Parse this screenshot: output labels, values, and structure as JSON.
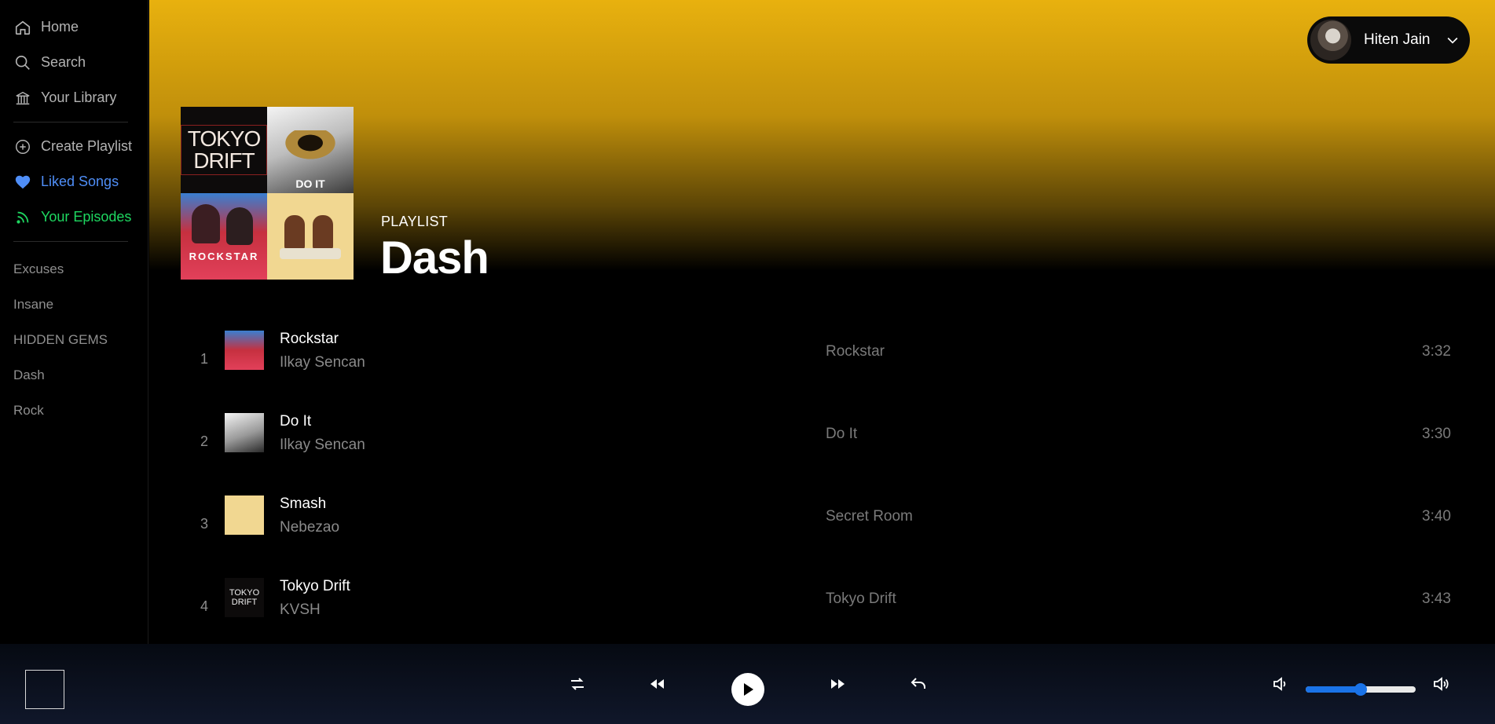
{
  "nav": {
    "home": "Home",
    "search": "Search",
    "library": "Your Library",
    "create_playlist": "Create Playlist",
    "liked_songs": "Liked Songs",
    "your_episodes": "Your Episodes"
  },
  "playlists": [
    "Excuses",
    "Insane",
    "HIDDEN GEMS",
    "Dash",
    "Rock"
  ],
  "user": {
    "name": "Hiten Jain"
  },
  "header": {
    "type": "PLAYLIST",
    "title": "Dash",
    "cover_labels": {
      "tokyo": "TOKYO DRIFT",
      "doit": "DO IT",
      "rockstar": "ROCKSTAR"
    }
  },
  "tracks": [
    {
      "number": "1",
      "title": "Rockstar",
      "artist": "Ilkay Sencan",
      "album": "Rockstar",
      "duration": "3:32",
      "art": "rockstar"
    },
    {
      "number": "2",
      "title": "Do It",
      "artist": "Ilkay Sencan",
      "album": "Do It",
      "duration": "3:30",
      "art": "doit"
    },
    {
      "number": "3",
      "title": "Smash",
      "artist": "Nebezao",
      "album": "Secret Room",
      "duration": "3:40",
      "art": "smash"
    },
    {
      "number": "4",
      "title": "Tokyo Drift",
      "artist": "KVSH",
      "album": "Tokyo Drift",
      "duration": "3:43",
      "art": "tokyo"
    }
  ],
  "player": {
    "controls": [
      "shuffle-icon",
      "rewind-icon",
      "play-icon",
      "fast-forward-icon",
      "repeat-icon"
    ],
    "volume_fraction": 0.5
  },
  "colors": {
    "gradient_top": "#e8b10e",
    "liked": "#4f8ef7",
    "episodes": "#1ed760",
    "volume_accent": "#1a73e8"
  }
}
